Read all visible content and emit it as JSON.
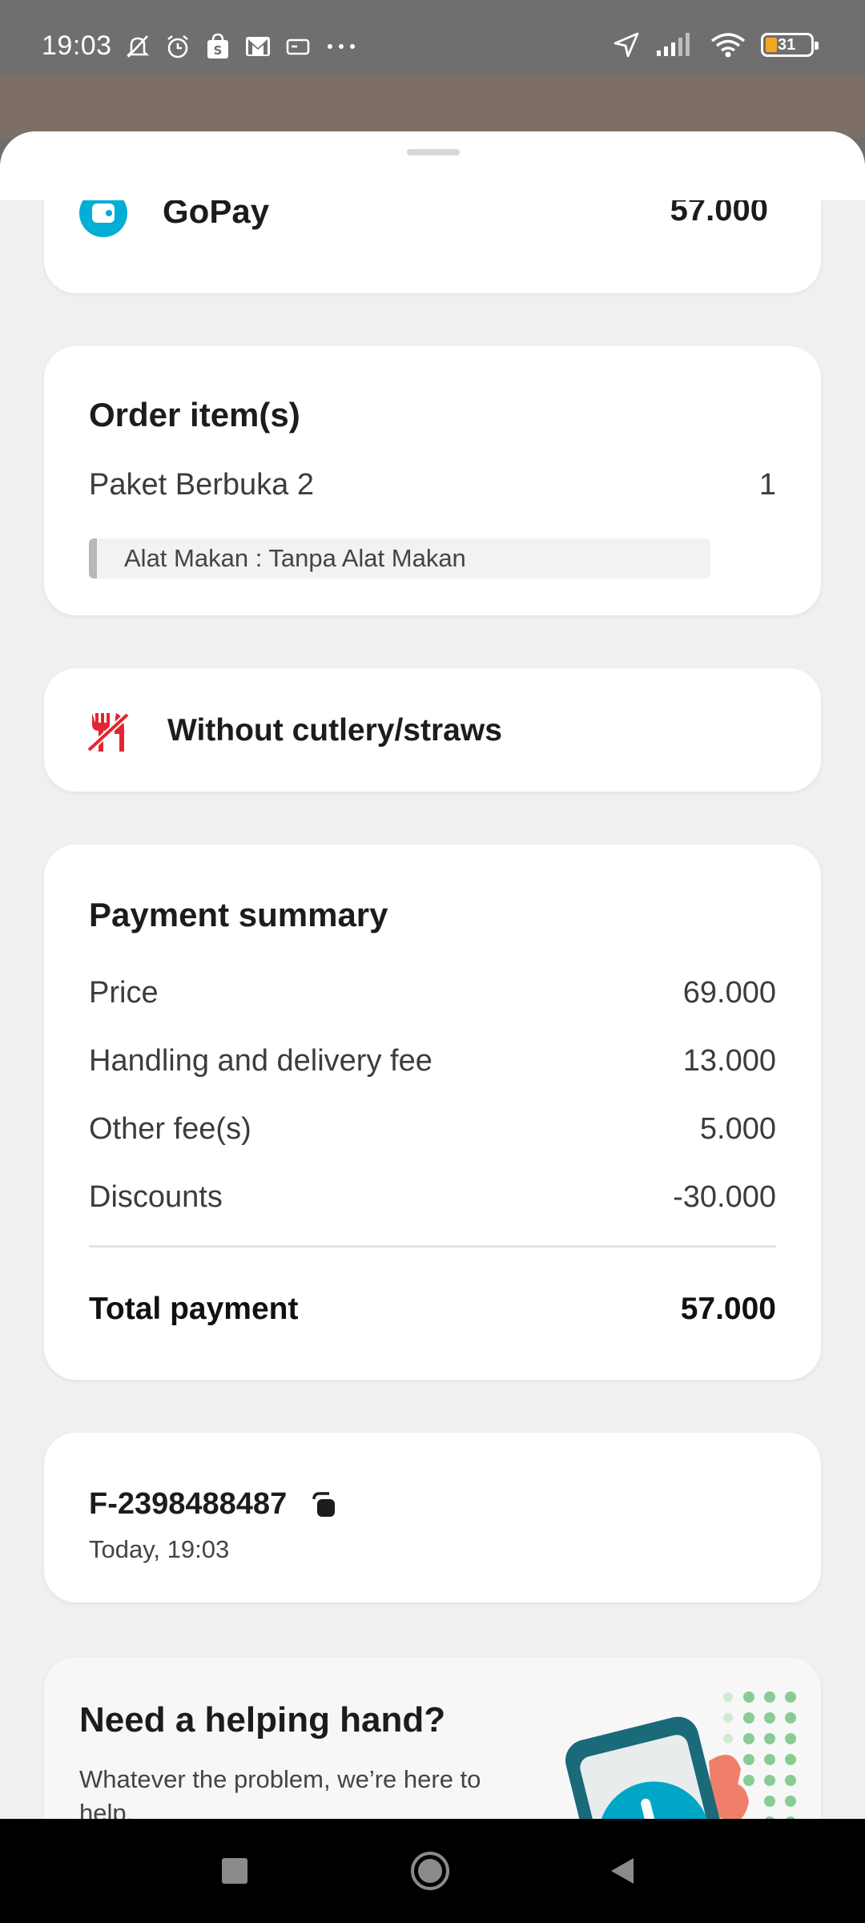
{
  "status_bar": {
    "time": "19:03",
    "battery": "31",
    "left_icons": [
      "mute-bell-icon",
      "alarm-icon",
      "shopee-icon",
      "gmail-icon",
      "card-icon",
      "more-dots-icon"
    ],
    "right_icons": [
      "location-icon",
      "signal-icon",
      "wifi-icon",
      "battery-icon"
    ]
  },
  "payment_method": {
    "name": "GoPay",
    "amount": "57.000",
    "icon": "wallet-icon",
    "color": "#00aed6"
  },
  "order_items": {
    "title": "Order item(s)",
    "items": [
      {
        "name": "Paket Berbuka 2",
        "qty": "1",
        "variant": "Alat Makan : Tanpa Alat Makan"
      }
    ]
  },
  "cutlery": {
    "label": "Without cutlery/straws",
    "icon": "no-cutlery-icon",
    "color": "#e3262f"
  },
  "payment_summary": {
    "title": "Payment summary",
    "rows": [
      {
        "label": "Price",
        "value": "69.000"
      },
      {
        "label": "Handling and delivery fee",
        "value": "13.000"
      },
      {
        "label": "Other fee(s)",
        "value": "5.000"
      },
      {
        "label": "Discounts",
        "value": "-30.000"
      }
    ],
    "total_label": "Total payment",
    "total_value": "57.000"
  },
  "order_info": {
    "order_id": "F-2398488487",
    "timestamp": "Today, 19:03"
  },
  "help": {
    "title": "Need a helping hand?",
    "subtitle": "Whatever the problem, we’re here to help."
  },
  "nav": {
    "buttons": [
      "recents-square-icon",
      "home-circle-icon",
      "back-triangle-icon"
    ]
  }
}
